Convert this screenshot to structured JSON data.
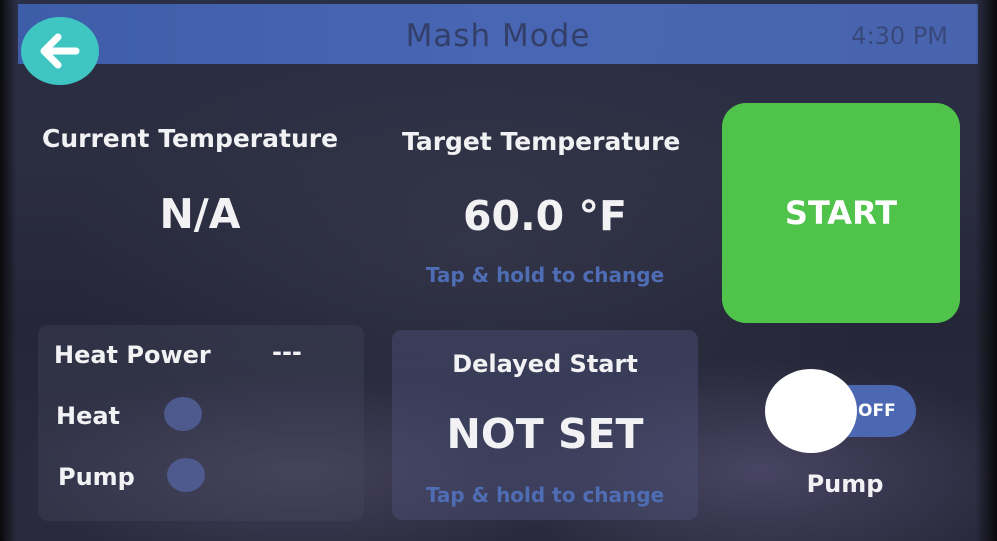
{
  "header": {
    "title": "Mash Mode",
    "time": "4:30 PM"
  },
  "current_temperature": {
    "label": "Current Temperature",
    "value": "N/A"
  },
  "target_temperature": {
    "label": "Target Temperature",
    "value": "60.0 °F",
    "hint": "Tap & hold to change"
  },
  "start_button": {
    "label": "START",
    "color": "#4fc34a"
  },
  "status": {
    "heat_power_label": "Heat Power",
    "heat_power_value": "---",
    "heat_label": "Heat",
    "pump_label": "Pump"
  },
  "delayed_start": {
    "label": "Delayed Start",
    "value": "NOT SET",
    "hint": "Tap & hold to change"
  },
  "pump_toggle": {
    "state": "OFF",
    "label": "Pump"
  },
  "colors": {
    "accent_teal": "#3fc6c2",
    "header_blue": "#4a69ba",
    "hint_blue": "#4f6db4"
  },
  "icons": {
    "back": "arrow-left-icon"
  }
}
